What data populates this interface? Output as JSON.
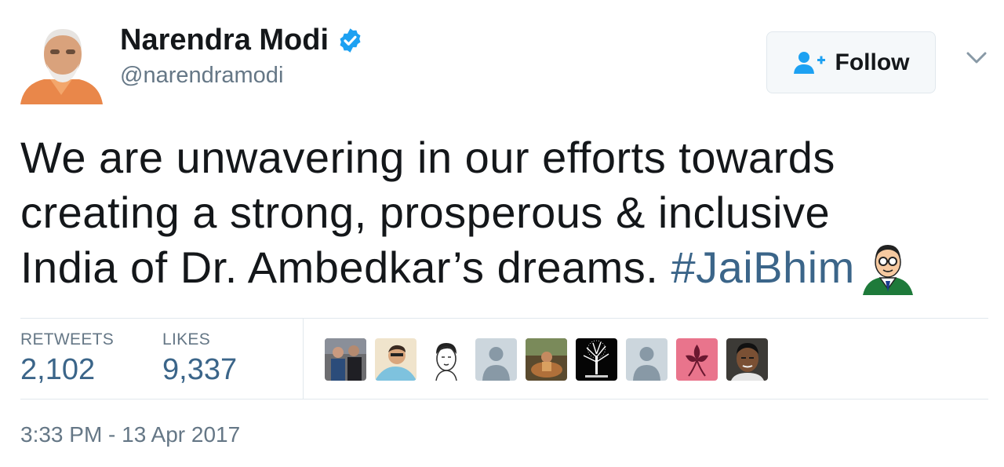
{
  "header": {
    "name": "Narendra Modi",
    "handle": "@narendramodi",
    "verified_icon": "verified-badge-icon",
    "follow_label": "Follow",
    "follow_icon": "add-user-icon",
    "menu_icon": "chevron-down-icon"
  },
  "tweet": {
    "text_line1": "We are unwavering in our efforts towards",
    "text_line2": "creating a strong, prosperous & inclusive",
    "text_line3": "India of Dr. Ambedkar’s dreams.",
    "hashtag": "#JaiBhim",
    "emoji": "ambedkar-emoji"
  },
  "stats": {
    "retweets_label": "RETWEETS",
    "retweets_value": "2,102",
    "likes_label": "LIKES",
    "likes_value": "9,337"
  },
  "likers": [
    {
      "icon": "liker-avatar-photo"
    },
    {
      "icon": "liker-avatar-photo"
    },
    {
      "icon": "liker-avatar-sketch"
    },
    {
      "icon": "default-avatar-icon"
    },
    {
      "icon": "liker-avatar-photo"
    },
    {
      "icon": "liker-avatar-tree"
    },
    {
      "icon": "default-avatar-icon"
    },
    {
      "icon": "liker-avatar-flower"
    },
    {
      "icon": "liker-avatar-photo"
    }
  ],
  "timestamp": "3:33 PM - 13 Apr 2017",
  "colors": {
    "text": "#14171a",
    "secondary": "#657786",
    "link": "#3b6589",
    "verified": "#1da1f2",
    "border": "#e1e8ed"
  }
}
